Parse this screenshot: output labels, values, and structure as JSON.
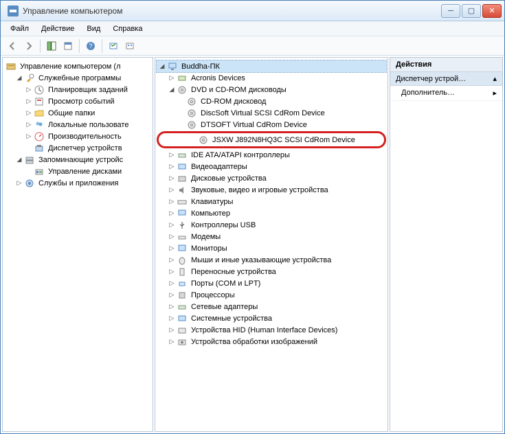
{
  "window": {
    "title": "Управление компьютером"
  },
  "menu": {
    "file": "Файл",
    "action": "Действие",
    "view": "Вид",
    "help": "Справка"
  },
  "left_tree": {
    "root": "Управление компьютером (л",
    "system_tools": "Служебные программы",
    "task_scheduler": "Планировщик заданий",
    "event_viewer": "Просмотр событий",
    "shared_folders": "Общие папки",
    "local_users": "Локальные пользовате",
    "performance": "Производительность",
    "device_manager": "Диспетчер устройств",
    "storage": "Запоминающие устройс",
    "disk_mgmt": "Управление дисками",
    "services_apps": "Службы и приложения"
  },
  "mid_tree": {
    "root": "Buddha-ПК",
    "acronis": "Acronis Devices",
    "dvdcd": "DVD и CD-ROM дисководы",
    "cdrom": "CD-ROM дисковод",
    "discsoft": "DiscSoft Virtual SCSI CdRom Device",
    "dtsoft": "DTSOFT Virtual CdRom Device",
    "jsxw": "JSXW J892N8HQ3C SCSI CdRom Device",
    "ide": "IDE ATA/ATAPI контроллеры",
    "video": "Видеоадаптеры",
    "disk": "Дисковые устройства",
    "sound": "Звуковые, видео и игровые устройства",
    "keyboard": "Клавиатуры",
    "computer": "Компьютер",
    "usb": "Контроллеры USB",
    "modem": "Модемы",
    "monitor": "Мониторы",
    "mouse": "Мыши и иные указывающие устройства",
    "imaging": "Переносные устройства",
    "ports": "Порты (COM и LPT)",
    "cpu": "Процессоры",
    "network": "Сетевые адаптеры",
    "system": "Системные устройства",
    "hid": "Устройства HID (Human Interface Devices)",
    "imaging2": "Устройства обработки изображений"
  },
  "right": {
    "header": "Действия",
    "sub": "Диспетчер устрой…",
    "item1": "Дополнитель…"
  }
}
